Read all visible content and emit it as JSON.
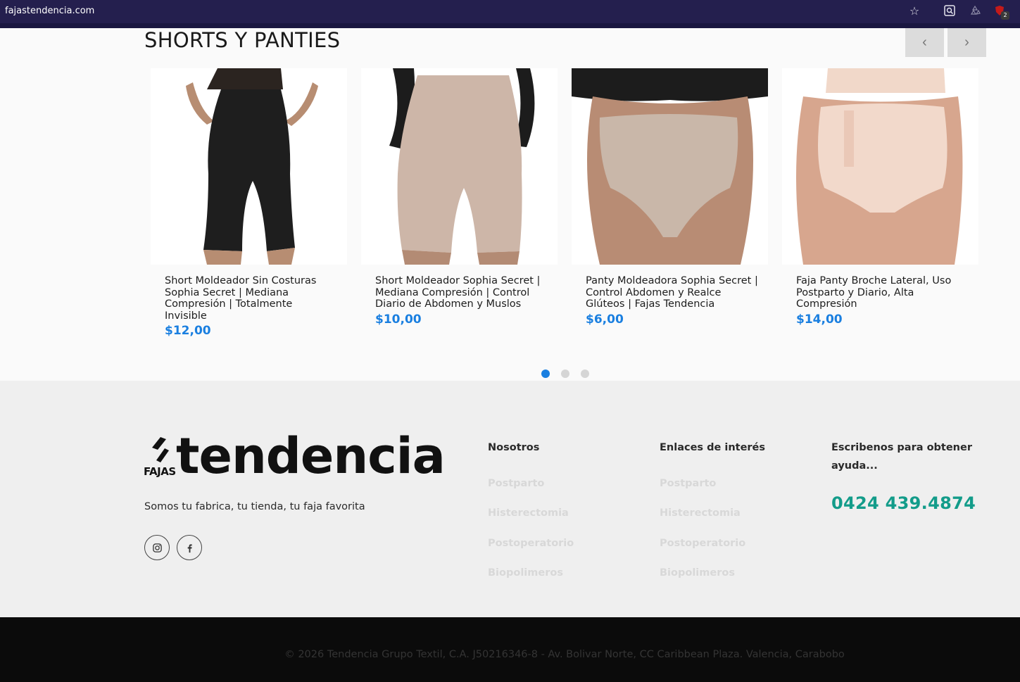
{
  "browser": {
    "url": "fajastendencia.com",
    "extension_badge": "2"
  },
  "section": {
    "title": "SHORTS Y PANTIES",
    "prev_label": "‹",
    "next_label": "›"
  },
  "products": [
    {
      "title": "Short Moldeador Sin Costuras Sophia Secret | Mediana Compresión | Totalmente Invisible",
      "price": "$12,00",
      "garment_color": "#1e1e1e",
      "style": "shorts"
    },
    {
      "title": "Short Moldeador Sophia Secret | Mediana Compresión | Control Diario de Abdomen y Muslos",
      "price": "$10,00",
      "garment_color": "#cdb6a8",
      "style": "shorts"
    },
    {
      "title": "Panty Moldeadora Sophia Secret | Control Abdomen y Realce Glúteos | Fajas Tendencia",
      "price": "$6,00",
      "garment_color": "#c9b7a9",
      "style": "panty"
    },
    {
      "title": "Faja Panty Broche Lateral, Uso Postparto y Diario, Alta Compresión",
      "price": "$14,00",
      "garment_color": "#f2d9cb",
      "style": "panty"
    }
  ],
  "carousel": {
    "pages": 3,
    "active_page": 1
  },
  "footer": {
    "logo_word": "tendencia",
    "logo_small": "FAJAS",
    "tagline": "Somos tu fabrica, tu tienda, tu faja favorita",
    "social": [
      "instagram-icon",
      "facebook-icon"
    ],
    "col1": {
      "heading": "Nosotros",
      "links": [
        "Postparto",
        "Histerectomia",
        "Postoperatorio",
        "Biopolimeros"
      ]
    },
    "col2": {
      "heading": "Enlaces de interés",
      "links": [
        "Postparto",
        "Histerectomia",
        "Postoperatorio",
        "Biopolimeros"
      ]
    },
    "col3": {
      "heading": "Escribenos para obtener ayuda...",
      "phone": "0424 439.4874"
    },
    "copyright": "© 2026 Tendencia Grupo Textil, C.A. J50216346-8 - Av. Bolivar Norte, CC Caribbean Plaza. Valencia, Carabobo"
  },
  "colors": {
    "accent_blue": "#1a7fe0",
    "phone_teal": "#139c8a",
    "browser_bar": "#241f4e"
  }
}
